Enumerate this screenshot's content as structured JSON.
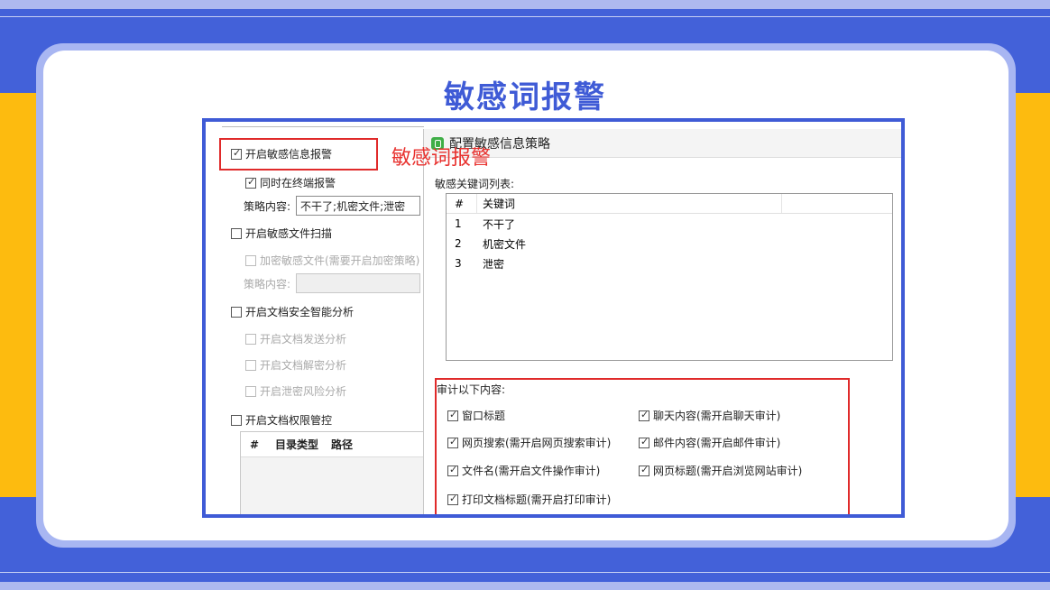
{
  "slide": {
    "title": "敏感词报警",
    "callout": "敏感词报警"
  },
  "left_panel": {
    "enable_alert": {
      "label": "开启敏感信息报警",
      "checked": true
    },
    "terminal_alert": {
      "label": "同时在终端报警",
      "checked": true
    },
    "policy_label": "策略内容:",
    "policy_value": "不干了;机密文件;泄密",
    "enable_file_scan": {
      "label": "开启敏感文件扫描",
      "checked": false
    },
    "encrypt_files": {
      "label": "加密敏感文件(需要开启加密策略)",
      "checked": false
    },
    "policy_label_2": "策略内容:",
    "policy_value_2": "",
    "enable_doc_analysis": {
      "label": "开启文档安全智能分析",
      "checked": false
    },
    "doc_send_analysis": {
      "label": "开启文档发送分析",
      "checked": false
    },
    "doc_decrypt_analysis": {
      "label": "开启文档解密分析",
      "checked": false
    },
    "leak_risk_analysis": {
      "label": "开启泄密风险分析",
      "checked": false
    },
    "enable_doc_permission": {
      "label": "开启文档权限管控",
      "checked": false
    },
    "table_headers": [
      "#",
      "目录类型",
      "路径"
    ]
  },
  "dialog": {
    "title": "配置敏感信息策略",
    "keyword_list_label": "敏感关键词列表:",
    "keyword_headers": [
      "#",
      "关键词"
    ],
    "keywords": [
      {
        "num": "1",
        "word": "不干了"
      },
      {
        "num": "2",
        "word": "机密文件"
      },
      {
        "num": "3",
        "word": "泄密"
      }
    ],
    "audit_label": "审计以下内容:",
    "audit_items": [
      {
        "label": "窗口标题",
        "checked": true
      },
      {
        "label": "聊天内容(需开启聊天审计)",
        "checked": true
      },
      {
        "label": "网页搜索(需开启网页搜索审计)",
        "checked": true
      },
      {
        "label": "邮件内容(需开启邮件审计)",
        "checked": true
      },
      {
        "label": "文件名(需开启文件操作审计)",
        "checked": true
      },
      {
        "label": "网页标题(需开启浏览网站审计)",
        "checked": true
      },
      {
        "label": "打印文档标题(需开启打印审计)",
        "checked": true
      }
    ]
  },
  "colors": {
    "background_blue": "#4361d9",
    "accent_yellow": "#fdbb0f",
    "title_blue": "#3f5bd6",
    "highlight_red": "#e02a2a"
  }
}
